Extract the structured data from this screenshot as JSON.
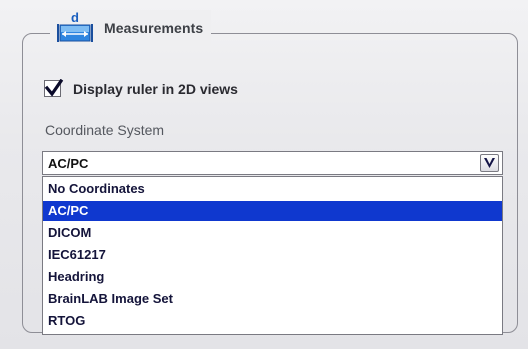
{
  "group": {
    "title": "Measurements",
    "icon": "measurement-d-icon"
  },
  "checkbox": {
    "label": "Display ruler in 2D views",
    "checked": true
  },
  "coordinate_system": {
    "label": "Coordinate System",
    "selected_value": "AC/PC",
    "options": [
      "No Coordinates",
      "AC/PC",
      "DICOM",
      "IEC61217",
      "Headring",
      "BrainLAB Image Set",
      "RTOG"
    ]
  },
  "colors": {
    "selection": "#0f38cf",
    "icon_blue": "#2a79d8",
    "frame": "#8e8e96"
  }
}
